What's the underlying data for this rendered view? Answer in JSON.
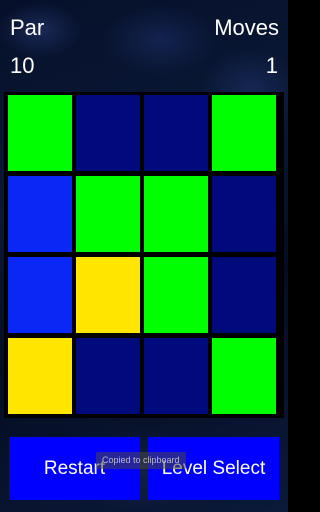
{
  "header": {
    "par_label": "Par",
    "par_value": "10",
    "moves_label": "Moves",
    "moves_value": "1"
  },
  "colors": {
    "dark_blue": "#000a7a",
    "blue": "#0a28f5",
    "green": "#00ff00",
    "yellow": "#ffe600",
    "button_blue": "#0000ff"
  },
  "board": {
    "rows": [
      [
        "green",
        "dark_blue",
        "dark_blue",
        "green"
      ],
      [
        "blue",
        "green",
        "green",
        "dark_blue"
      ],
      [
        "blue",
        "yellow",
        "green",
        "dark_blue"
      ],
      [
        "yellow",
        "dark_blue",
        "dark_blue",
        "green"
      ]
    ]
  },
  "buttons": {
    "restart_label": "Restart",
    "level_select_label": "Level Select"
  },
  "toast": {
    "text": "Copied to clipboard"
  }
}
